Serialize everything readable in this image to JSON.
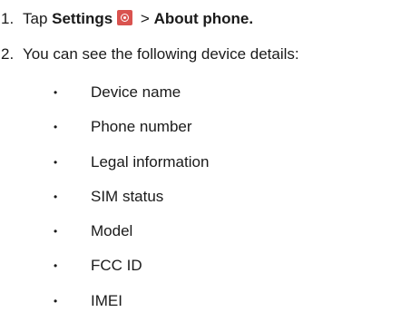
{
  "steps": [
    {
      "number": "1.",
      "prefix": "Tap ",
      "bold_settings": "Settings",
      "icon": "settings-gear-icon",
      "separator": " > ",
      "bold_about": "About phone."
    },
    {
      "number": "2.",
      "text": "You can see the following device details:"
    }
  ],
  "bullet_char": "•",
  "details": [
    "Device name",
    "Phone number",
    "Legal information",
    "SIM status",
    "Model",
    "FCC ID",
    "IMEI"
  ],
  "colors": {
    "settings_icon_bg": "#d9534f",
    "text": "#1a1a1a"
  }
}
